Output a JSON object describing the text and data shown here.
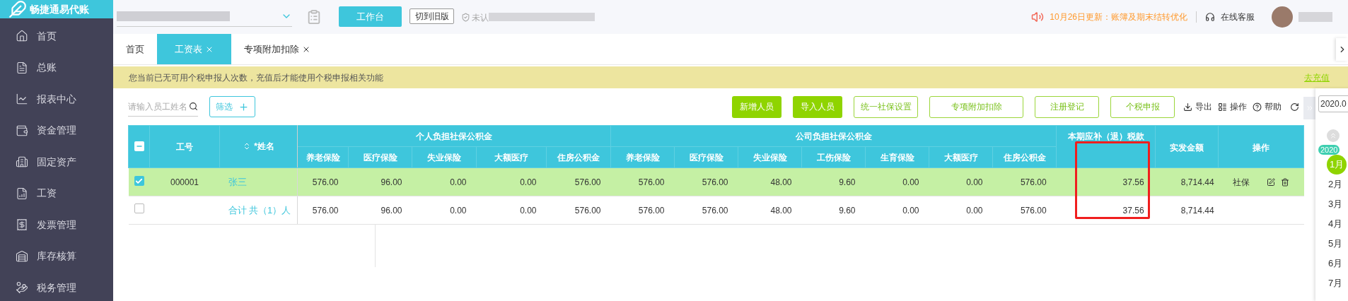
{
  "app": {
    "logo_text": "畅捷通易代账"
  },
  "header": {
    "workbench_button": "工作台",
    "switch_button": "切到旧版",
    "cert_status": "未认",
    "announcement": "10月26日更新：账簿及期末结转优化",
    "support": "在线客服"
  },
  "sidebar": {
    "items": [
      "首页",
      "总账",
      "报表中心",
      "资金管理",
      "固定资产",
      "工资",
      "发票管理",
      "库存核算",
      "税务管理"
    ]
  },
  "tabs": [
    {
      "label": "首页",
      "selected": false,
      "closable": false
    },
    {
      "label": "工资表",
      "selected": true,
      "closable": true
    },
    {
      "label": "专项附加扣除",
      "selected": false,
      "closable": true
    }
  ],
  "notice": {
    "text": "您当前已无可用个税申报人次数，充值后才能使用个税申报相关功能",
    "link": "去充值"
  },
  "toolbar": {
    "search": {
      "placeholder": "请输入员工姓名"
    },
    "filter_button": "筛选",
    "buttons": [
      {
        "label": "新增人员",
        "kind": "solid"
      },
      {
        "label": "导入人员",
        "kind": "solid"
      },
      {
        "label": "统一社保设置",
        "kind": "outline"
      },
      {
        "label": "专项附加扣除",
        "kind": "outline"
      },
      {
        "label": "注册登记",
        "kind": "outline"
      },
      {
        "label": "个税申报",
        "kind": "outline"
      }
    ],
    "actions": [
      {
        "label": "导出",
        "kind": "export"
      },
      {
        "label": "操作",
        "kind": "columns"
      },
      {
        "label": "帮助",
        "kind": "help"
      }
    ]
  },
  "table": {
    "header_checkbox": {
      "indeterminate": true
    },
    "columns": {
      "id": "工号",
      "name": "*姓名",
      "personal_group": "个人负担社保公积金",
      "personal": [
        "养老保险",
        "医疗保险",
        "失业保险",
        "大额医疗",
        "住房公积金"
      ],
      "company_group": "公司负担社保公积金",
      "company": [
        "养老保险",
        "医疗保险",
        "失业保险",
        "工伤保险",
        "生育保险",
        "大额医疗",
        "住房公积金"
      ],
      "tax": "本期应补（退）税款",
      "net": "实发金额",
      "actions": "操作"
    },
    "tax_highlighted": true,
    "rows": [
      {
        "selected": true,
        "id": "000001",
        "name": "张三",
        "personal": [
          "576.00",
          "96.00",
          "0.00",
          "0.00",
          "576.00"
        ],
        "company": [
          "576.00",
          "576.00",
          "48.00",
          "9.60",
          "0.00",
          "0.00",
          "576.00"
        ],
        "tax": "37.56",
        "net": "8,714.44",
        "action_label": "社保",
        "editable": true
      },
      {
        "selected": false,
        "name": "合计 共（1）人",
        "personal": [
          "576.00",
          "96.00",
          "0.00",
          "0.00",
          "576.00"
        ],
        "company": [
          "576.00",
          "576.00",
          "48.00",
          "9.60",
          "0.00",
          "0.00",
          "576.00"
        ],
        "tax": "37.56",
        "net": "8,714.44",
        "editable": false
      }
    ]
  },
  "calendar": {
    "date_input": "2020.0",
    "year_badge": "2020",
    "months": [
      {
        "label": "1月",
        "selected": true
      },
      {
        "label": "2月",
        "selected": false
      },
      {
        "label": "3月",
        "selected": false
      },
      {
        "label": "4月",
        "selected": false
      },
      {
        "label": "5月",
        "selected": false
      },
      {
        "label": "6月",
        "selected": false
      },
      {
        "label": "7月",
        "selected": false
      }
    ]
  }
}
